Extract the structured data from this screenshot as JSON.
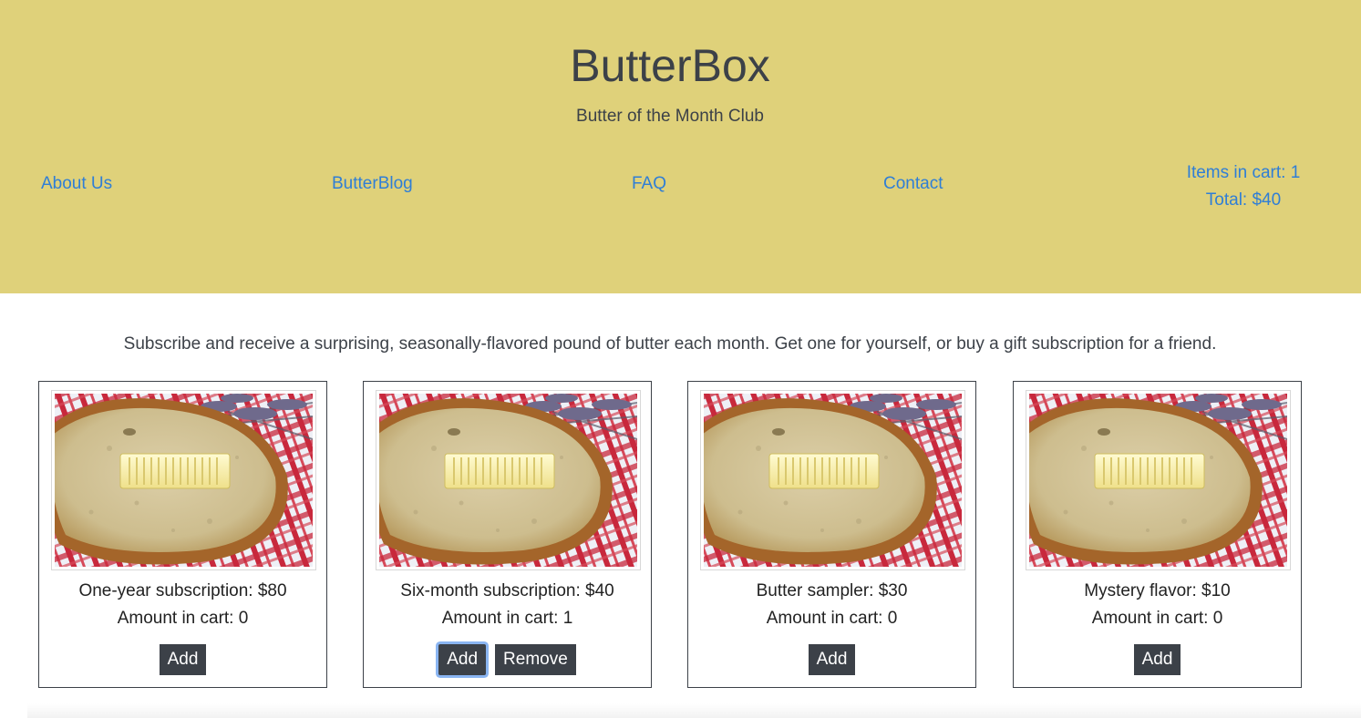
{
  "header": {
    "title": "ButterBox",
    "tagline": "Butter of the Month Club",
    "background_color": "#dfd17a"
  },
  "nav": {
    "links": [
      {
        "label": "About Us"
      },
      {
        "label": "ButterBlog"
      },
      {
        "label": "FAQ"
      },
      {
        "label": "Contact"
      }
    ],
    "link_color": "#2f7ed6"
  },
  "cart": {
    "items_text": "Items in cart: 1",
    "total_text": "Total: $40"
  },
  "intro": {
    "text": "Subscribe and receive a surprising, seasonally-flavored pound of butter each month. Get one for yourself, or buy a gift subscription for a friend."
  },
  "products": [
    {
      "name": "One-year subscription: $80",
      "amount_text": "Amount in cart: 0",
      "add_label": "Add",
      "remove_label": null
    },
    {
      "name": "Six-month subscription: $40",
      "amount_text": "Amount in cart: 1",
      "add_label": "Add",
      "remove_label": "Remove"
    },
    {
      "name": "Butter sampler: $30",
      "amount_text": "Amount in cart: 0",
      "add_label": "Add",
      "remove_label": null
    },
    {
      "name": "Mystery flavor: $10",
      "amount_text": "Amount in cart: 0",
      "add_label": "Add",
      "remove_label": null
    }
  ],
  "icons": {
    "product_image": "butter-on-bread-photo"
  },
  "button_color": "#3c4148"
}
